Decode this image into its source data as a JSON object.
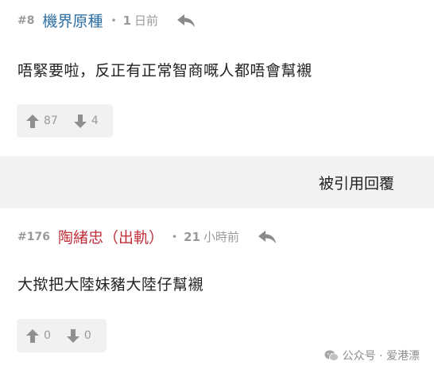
{
  "posts": [
    {
      "number": "#8",
      "author": "機界原種",
      "time_value": "1",
      "time_unit": "日前",
      "content": "唔緊要啦，反正有正常智商嘅人都唔會幫襯",
      "upvotes": "87",
      "downvotes": "4"
    },
    {
      "number": "#176",
      "author": "陶緒忠（出軌）",
      "time_value": "21",
      "time_unit": "小時前",
      "content": "大揿把大陸妹豬大陸仔幫襯",
      "upvotes": "0",
      "downvotes": "0"
    }
  ],
  "quote_link": "被引用回覆",
  "separator": "•",
  "watermark": "公众号 · 爱港漂",
  "icons": {
    "reply": "reply-arrow-icon",
    "upvote": "arrow-up-icon",
    "downvote": "arrow-down-icon",
    "watermark": "wechat-icon"
  },
  "colors": {
    "author_1": "#2e6fa3",
    "author_2": "#c0303a",
    "muted": "#9a9a9a",
    "band": "#f3f3f3"
  }
}
